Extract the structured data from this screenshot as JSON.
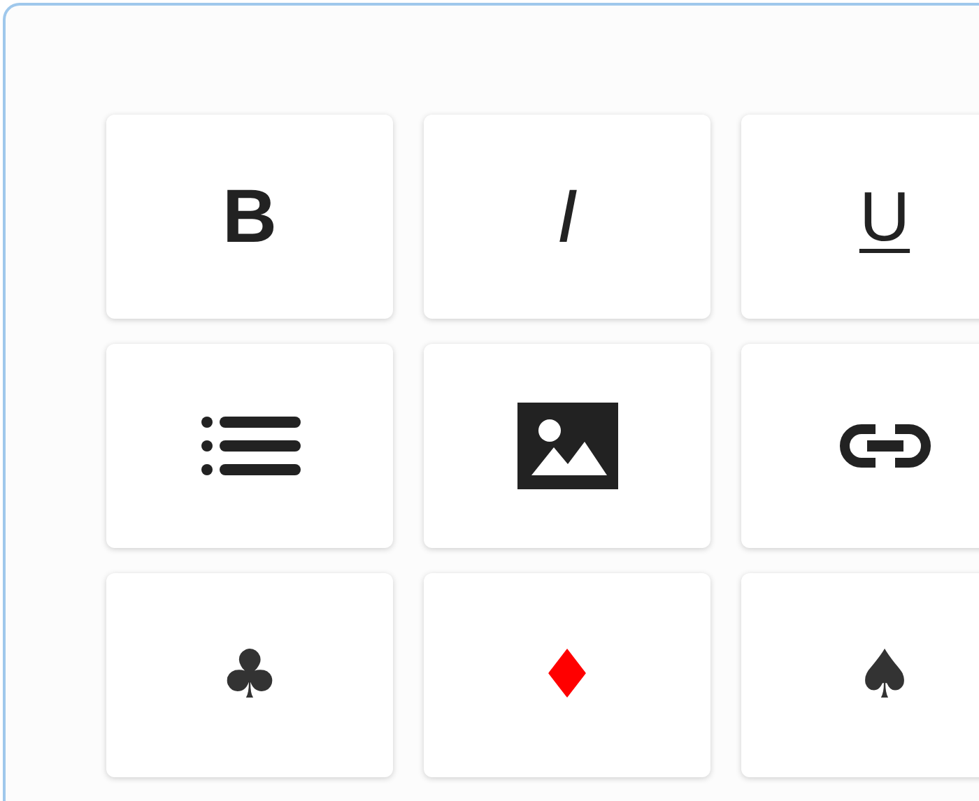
{
  "buttons": [
    {
      "kind": "bold",
      "label": "B"
    },
    {
      "kind": "italic",
      "label": "I"
    },
    {
      "kind": "underline",
      "label": "U"
    },
    {
      "kind": "list"
    },
    {
      "kind": "image"
    },
    {
      "kind": "link"
    },
    {
      "kind": "symbol",
      "label": "♣",
      "color": "#333333"
    },
    {
      "kind": "symbol",
      "label": "♦",
      "color": "#ff0000"
    },
    {
      "kind": "symbol",
      "label": "♠",
      "color": "#333333"
    }
  ]
}
